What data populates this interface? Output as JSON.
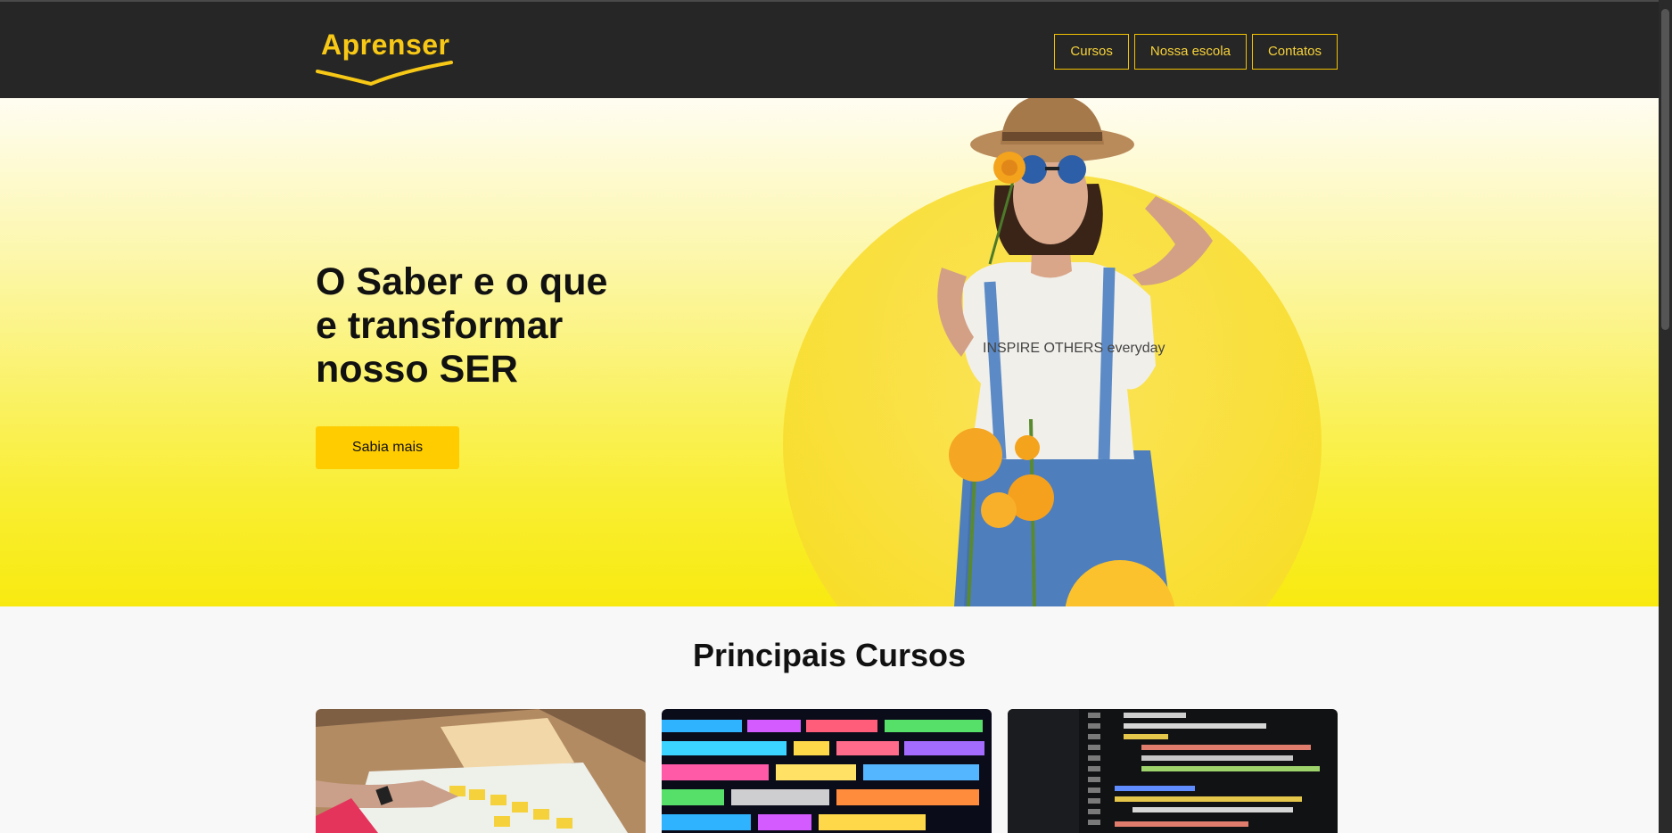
{
  "brand": {
    "name": "Aprenser",
    "color": "#f7c816"
  },
  "nav": {
    "items": [
      {
        "label": "Cursos"
      },
      {
        "label": "Nossa escola"
      },
      {
        "label": "Contatos"
      }
    ]
  },
  "hero": {
    "headline": "O Saber e o que e transformar nosso SER",
    "cta_label": "Sabia mais",
    "shirt_text": "INSPIRE OTHERS everyday"
  },
  "courses": {
    "title": "Principais Cursos",
    "cards": [
      {
        "name": "planning-photo"
      },
      {
        "name": "code-colorful-photo"
      },
      {
        "name": "code-editor-photo"
      }
    ]
  },
  "colors": {
    "header_bg": "#262626",
    "accent": "#ffcc00",
    "nav_border": "#f2c200",
    "hero_bottom": "#f8ea10"
  }
}
